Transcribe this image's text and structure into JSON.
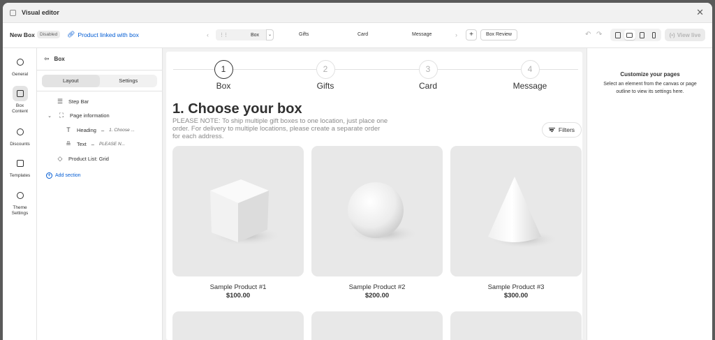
{
  "window": {
    "title": "Visual editor"
  },
  "toolbar": {
    "box_name": "New Box",
    "status_badge": "Disabled",
    "product_link": "Product linked with box",
    "current_step": "Box",
    "steps": [
      "Gifts",
      "Card",
      "Message"
    ],
    "review_button": "Box Review",
    "view_live": "View live"
  },
  "rail": {
    "items": [
      {
        "label": "General"
      },
      {
        "label": "Box Content"
      },
      {
        "label": "Discounts"
      },
      {
        "label": "Templates"
      },
      {
        "label": "Theme Settings"
      }
    ]
  },
  "panel": {
    "title": "Box",
    "tabs": [
      "Layout",
      "Settings"
    ],
    "tree": [
      {
        "label": "Step Bar"
      },
      {
        "label": "Page information"
      },
      {
        "label": "Heading",
        "sub": "1. Choose ..."
      },
      {
        "label": "Text",
        "sub": "PLEASE N..."
      },
      {
        "label": "Product List: Grid"
      }
    ],
    "add_section": "Add section"
  },
  "canvas": {
    "steps": [
      {
        "num": "1",
        "name": "Box"
      },
      {
        "num": "2",
        "name": "Gifts"
      },
      {
        "num": "3",
        "name": "Card"
      },
      {
        "num": "4",
        "name": "Message"
      }
    ],
    "heading": "1. Choose your box",
    "note": "PLEASE NOTE: To ship multiple gift boxes to one location, just place one order. For delivery to multiple locations, please create a separate order for each address.",
    "filters": "Filters",
    "products": [
      {
        "name": "Sample Product #1",
        "price": "$100.00"
      },
      {
        "name": "Sample Product #2",
        "price": "$200.00"
      },
      {
        "name": "Sample Product #3",
        "price": "$300.00"
      }
    ]
  },
  "props": {
    "title": "Customize your pages",
    "body": "Select an element from the canvas or page outline to view its settings here."
  }
}
